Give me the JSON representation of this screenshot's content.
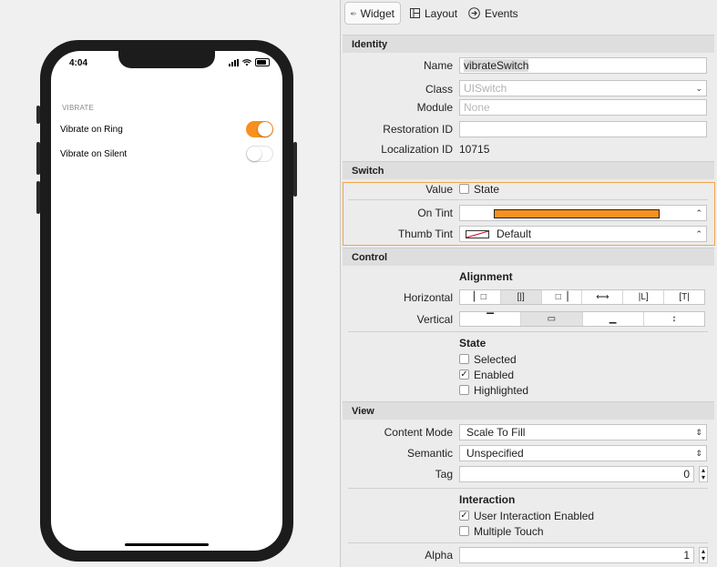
{
  "phone": {
    "time": "4:04",
    "section_header": "VIBRATE",
    "rows": [
      {
        "label": "Vibrate on Ring",
        "on": true
      },
      {
        "label": "Vibrate on Silent",
        "on": false
      }
    ]
  },
  "tabs": {
    "widget": "Widget",
    "layout": "Layout",
    "events": "Events"
  },
  "identity": {
    "header": "Identity",
    "name_label": "Name",
    "name_value": "vibrateSwitch",
    "class_label": "Class",
    "class_value": "UISwitch",
    "module_label": "Module",
    "module_placeholder": "None",
    "restoration_label": "Restoration ID",
    "restoration_value": "",
    "localization_label": "Localization ID",
    "localization_value": "10715"
  },
  "switch": {
    "header": "Switch",
    "value_label": "Value",
    "state_label": "State",
    "on_tint_label": "On Tint",
    "on_tint_color": "#f7901e",
    "thumb_tint_label": "Thumb Tint",
    "thumb_tint_value": "Default"
  },
  "control": {
    "header": "Control",
    "alignment_label": "Alignment",
    "horizontal_label": "Horizontal",
    "vertical_label": "Vertical",
    "state_label": "State",
    "selected_label": "Selected",
    "enabled_label": "Enabled",
    "highlighted_label": "Highlighted",
    "selected": false,
    "enabled": true,
    "highlighted": false
  },
  "view": {
    "header": "View",
    "content_mode_label": "Content Mode",
    "content_mode_value": "Scale To Fill",
    "semantic_label": "Semantic",
    "semantic_value": "Unspecified",
    "tag_label": "Tag",
    "tag_value": "0",
    "interaction_label": "Interaction",
    "user_interaction_label": "User Interaction Enabled",
    "multiple_touch_label": "Multiple Touch",
    "alpha_label": "Alpha",
    "alpha_value": "1"
  },
  "colors": {
    "accent_orange": "#f7901e",
    "highlight_border": "#f0a64b"
  }
}
